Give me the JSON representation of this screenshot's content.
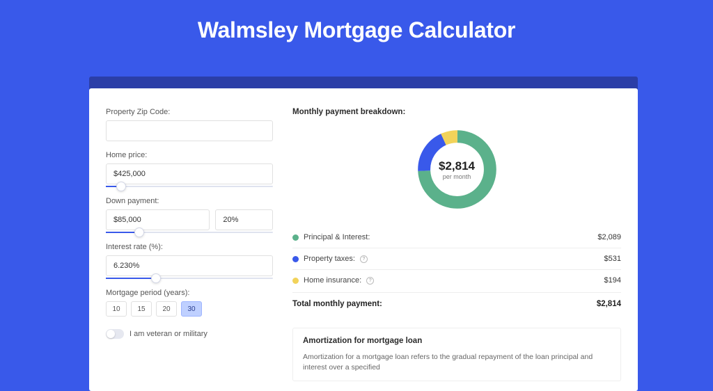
{
  "title": "Walmsley Mortgage Calculator",
  "form": {
    "zip": {
      "label": "Property Zip Code:",
      "value": ""
    },
    "home_price": {
      "label": "Home price:",
      "value": "$425,000",
      "slider_pct": 9
    },
    "down_payment": {
      "label": "Down payment:",
      "amount": "$85,000",
      "percent": "20%",
      "slider_pct": 20
    },
    "interest_rate": {
      "label": "Interest rate (%):",
      "value": "6.230%",
      "slider_pct": 30
    },
    "period": {
      "label": "Mortgage period (years):",
      "options": [
        "10",
        "15",
        "20",
        "30"
      ],
      "active": "30"
    },
    "veteran": {
      "label": "I am veteran or military",
      "checked": false
    }
  },
  "breakdown": {
    "title": "Monthly payment breakdown:",
    "center_amount": "$2,814",
    "center_sub": "per month",
    "items": [
      {
        "label": "Principal & Interest:",
        "value": "$2,089",
        "color": "green",
        "info": false
      },
      {
        "label": "Property taxes:",
        "value": "$531",
        "color": "blue",
        "info": true
      },
      {
        "label": "Home insurance:",
        "value": "$194",
        "color": "yellow",
        "info": true
      }
    ],
    "total_label": "Total monthly payment:",
    "total_value": "$2,814"
  },
  "amortization": {
    "title": "Amortization for mortgage loan",
    "text": "Amortization for a mortgage loan refers to the gradual repayment of the loan principal and interest over a specified"
  },
  "chart_data": {
    "type": "pie",
    "title": "Monthly payment breakdown",
    "series": [
      {
        "name": "Principal & Interest",
        "value": 2089,
        "color": "#5bb18b"
      },
      {
        "name": "Property taxes",
        "value": 531,
        "color": "#3959ea"
      },
      {
        "name": "Home insurance",
        "value": 194,
        "color": "#f2d35a"
      }
    ],
    "total": 2814,
    "center_label": "$2,814 per month"
  }
}
